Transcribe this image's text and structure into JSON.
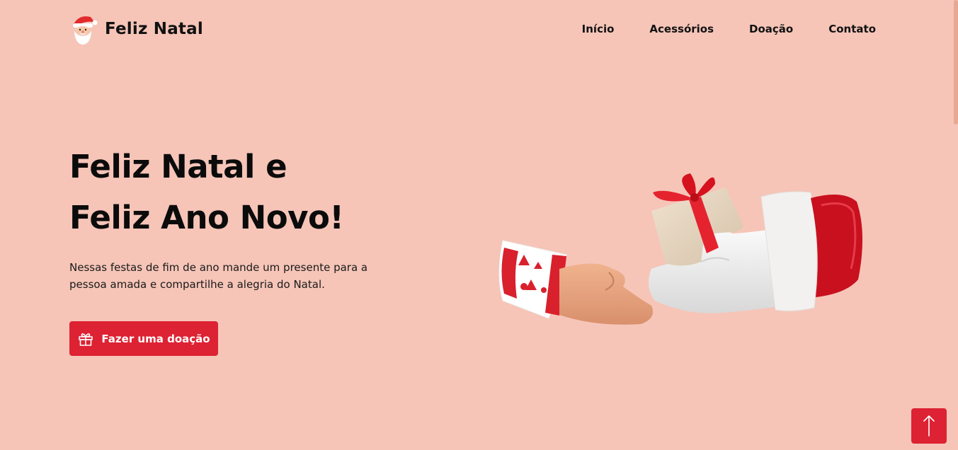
{
  "brand": {
    "name": "Feliz Natal",
    "logo_icon": "santa-claus-icon"
  },
  "nav": {
    "items": [
      {
        "label": "Início"
      },
      {
        "label": "Acessórios"
      },
      {
        "label": "Doação"
      },
      {
        "label": "Contato"
      }
    ]
  },
  "hero": {
    "title_line1": "Feliz Natal e",
    "title_line2": "Feliz Ano Novo!",
    "description": "Nessas festas de fim de ano mande um presente para a pessoa amada e compartilhe a alegria do Natal.",
    "cta_label": "Fazer uma doação",
    "cta_icon": "gift-icon",
    "illustration": "hands-exchanging-gift-illustration"
  },
  "back_to_top": {
    "icon": "arrow-up-icon"
  },
  "colors": {
    "background": "#f6c5b8",
    "accent": "#dd2233",
    "text": "#111111"
  }
}
